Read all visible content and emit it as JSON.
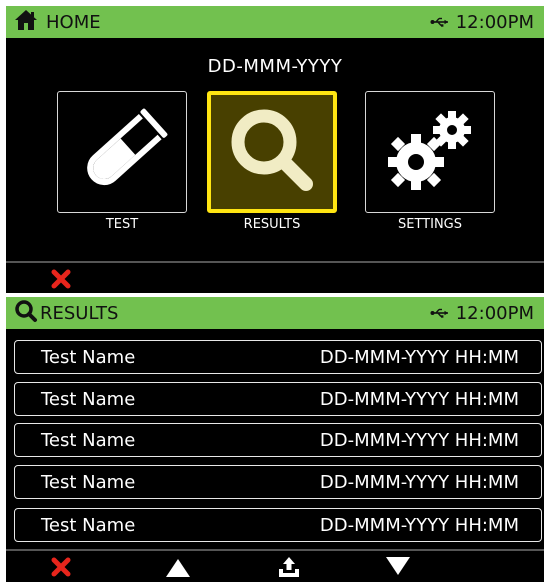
{
  "home": {
    "title": "HOME",
    "time": "12:00PM",
    "date": "DD-MMM-YYYY",
    "tiles": [
      {
        "label": "TEST"
      },
      {
        "label": "RESULTS"
      },
      {
        "label": "SETTINGS"
      }
    ],
    "selected_tile": "RESULTS"
  },
  "results": {
    "title": "RESULTS",
    "time": "12:00PM",
    "rows": [
      {
        "name": "Test Name",
        "datetime": "DD-MMM-YYYY HH:MM"
      },
      {
        "name": "Test Name",
        "datetime": "DD-MMM-YYYY HH:MM"
      },
      {
        "name": "Test Name",
        "datetime": "DD-MMM-YYYY HH:MM"
      },
      {
        "name": "Test Name",
        "datetime": "DD-MMM-YYYY HH:MM"
      },
      {
        "name": "Test Name",
        "datetime": "DD-MMM-YYYY HH:MM"
      }
    ]
  },
  "icons": {
    "home": "home-icon",
    "usb": "usb-icon",
    "close": "close-icon",
    "test_tube": "test-tube-icon",
    "magnifier": "magnifier-icon",
    "gears": "gears-icon",
    "up": "arrow-up-icon",
    "export": "export-icon",
    "down": "arrow-down-icon"
  },
  "colors": {
    "status_bar": "#72c14f",
    "highlight_border": "#ffe512",
    "highlight_fill": "#484000",
    "close_red": "#e8251c",
    "screen_bg": "#000000"
  }
}
